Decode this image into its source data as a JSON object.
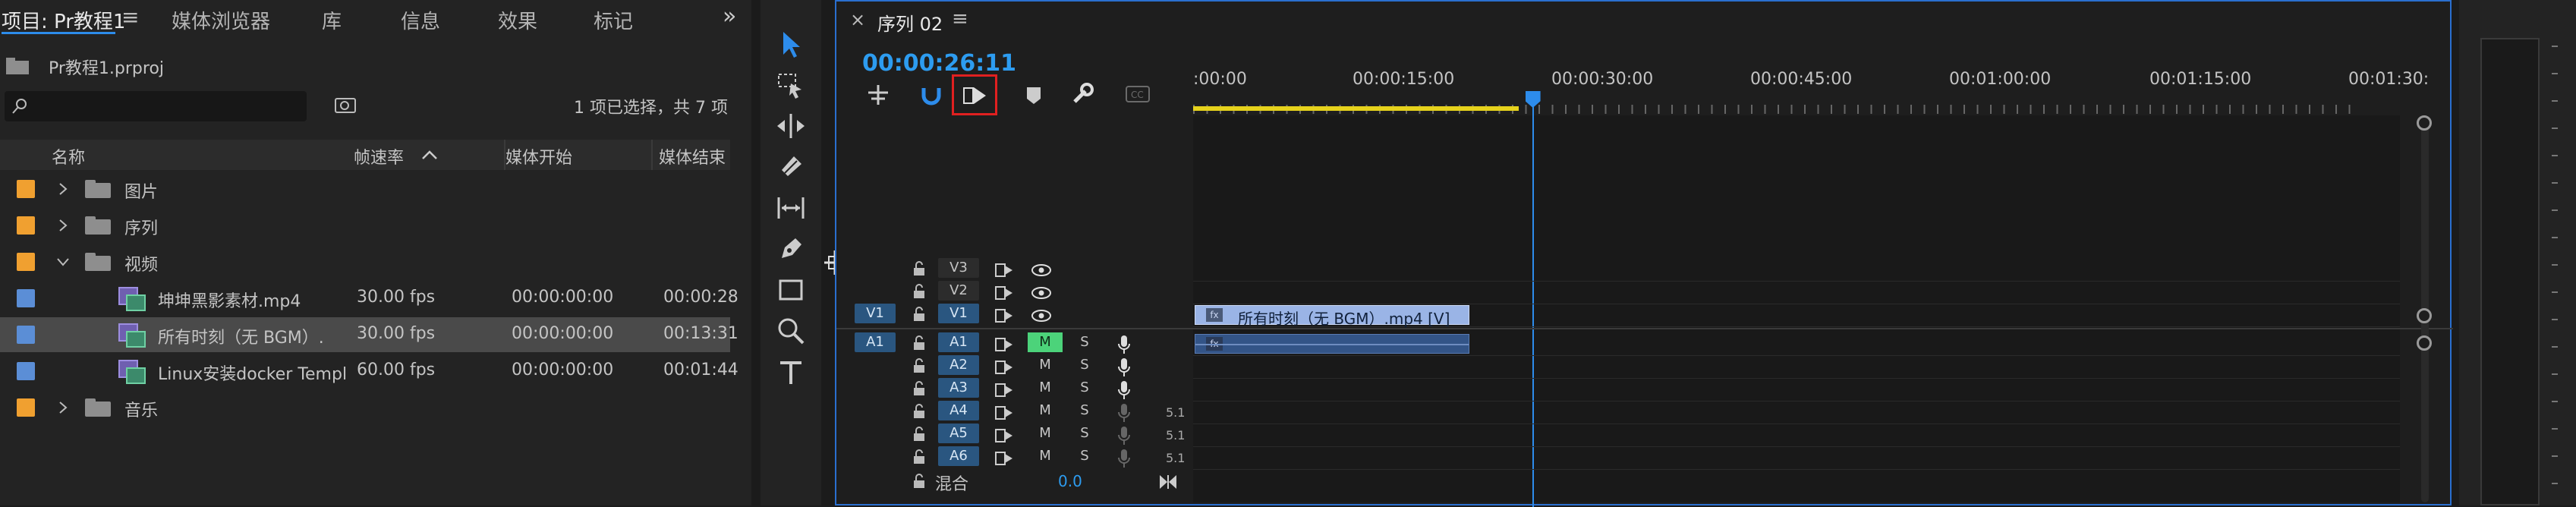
{
  "project_panel": {
    "tabs": [
      "项目: Pr教程1",
      "媒体浏览器",
      "库",
      "信息",
      "效果",
      "标记"
    ],
    "overflow_label": "»",
    "project_file": "Pr教程1.prproj",
    "search_placeholder": "",
    "selection_status": "1 项已选择，共 7 项",
    "columns": [
      "名称",
      "帧速率",
      "媒体开始",
      "媒体结束"
    ],
    "rows": [
      {
        "type": "folder",
        "name": "图片",
        "expanded": false,
        "color": "#f0a030",
        "fps": "",
        "start": "",
        "end": ""
      },
      {
        "type": "folder",
        "name": "序列",
        "expanded": false,
        "color": "#f0a030",
        "fps": "",
        "start": "",
        "end": ""
      },
      {
        "type": "folder",
        "name": "视频",
        "expanded": true,
        "color": "#f0a030",
        "fps": "",
        "start": "",
        "end": ""
      },
      {
        "type": "clip",
        "name": "坤坤黑影素材.mp4",
        "color": "#5b8ed6",
        "fps": "30.00 fps",
        "start": "00:00:00:00",
        "end": "00:00:28"
      },
      {
        "type": "clip",
        "name": "所有时刻（无 BGM）.",
        "color": "#5b8ed6",
        "fps": "30.00 fps",
        "start": "00:00:00:00",
        "end": "00:13:31",
        "selected": true
      },
      {
        "type": "clip",
        "name": "Linux安装docker Templ",
        "color": "#5b8ed6",
        "fps": "60.00 fps",
        "start": "00:00:00:00",
        "end": "00:01:44"
      },
      {
        "type": "folder",
        "name": "音乐",
        "expanded": false,
        "color": "#f0a030",
        "fps": "",
        "start": "",
        "end": ""
      }
    ]
  },
  "tools": [
    "selection-tool",
    "track-select-tool",
    "ripple-edit-tool",
    "razor-tool",
    "slip-tool",
    "pen-tool",
    "rectangle-tool",
    "hand-tool",
    "type-tool"
  ],
  "timeline": {
    "close_label": "×",
    "sequence_name": "序列 02",
    "menu_label": "≡",
    "timecode": "00:00:26:11",
    "ruler_labels": [
      ":00:00",
      "00:00:15:00",
      "00:00:30:00",
      "00:00:45:00",
      "00:01:00:00",
      "00:01:15:00",
      "00:01:30:"
    ],
    "video_tracks": [
      {
        "name": "V3",
        "source": ""
      },
      {
        "name": "V2",
        "source": ""
      },
      {
        "name": "V1",
        "source": "V1"
      }
    ],
    "audio_tracks": [
      {
        "name": "A1",
        "source": "A1",
        "m": "M",
        "s": "S",
        "mute_active": true,
        "extra": ""
      },
      {
        "name": "A2",
        "m": "M",
        "s": "S",
        "extra": ""
      },
      {
        "name": "A3",
        "m": "M",
        "s": "S",
        "extra": ""
      },
      {
        "name": "A4",
        "m": "M",
        "s": "S",
        "extra": "5.1"
      },
      {
        "name": "A5",
        "m": "M",
        "s": "S",
        "extra": "5.1"
      },
      {
        "name": "A6",
        "m": "M",
        "s": "S",
        "extra": "5.1"
      }
    ],
    "mix_label": "混合",
    "mix_value": "0.0",
    "video_clip_label": "所有时刻（无 BGM）.mp4 [V]",
    "video_clip_badge": "fx",
    "audio_clip_badge": "fx",
    "playhead_progress": 0.29
  },
  "colors": {
    "accent": "#2d8ceb",
    "selection_highlight": "#e02020",
    "timecode": "#2d9cf0",
    "yellow_bar": "#e6d21c"
  }
}
